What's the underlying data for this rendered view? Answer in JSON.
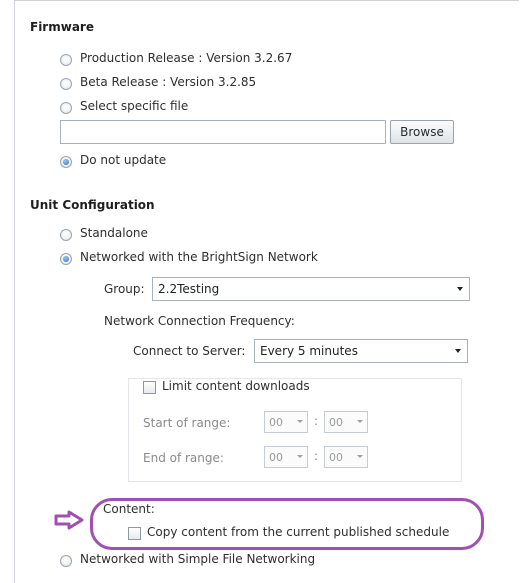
{
  "firmware": {
    "heading": "Firmware",
    "options": [
      {
        "label": "Production Release : Version 3.2.67",
        "selected": false
      },
      {
        "label": "Beta Release : Version 3.2.85",
        "selected": false
      },
      {
        "label": "Select specific file",
        "selected": false
      }
    ],
    "file_path": "",
    "browse_label": "Browse",
    "do_not_update": {
      "label": "Do not update",
      "selected": true
    }
  },
  "unit_config": {
    "heading": "Unit Configuration",
    "standalone": {
      "label": "Standalone",
      "selected": false
    },
    "networked": {
      "label": "Networked with the BrightSign Network",
      "selected": true
    },
    "group_label": "Group:",
    "group_value": "2.2Testing",
    "frequency_label": "Network Connection Frequency:",
    "connect_label": "Connect to Server:",
    "connect_value": "Every 5 minutes",
    "limit": {
      "label": "Limit content downloads",
      "checked": false
    },
    "start_label": "Start of range:",
    "end_label": "End of range:",
    "start_hour": "00",
    "start_minute": "00",
    "end_hour": "00",
    "end_minute": "00",
    "time_separator": ":",
    "content_label": "Content:",
    "copy_content": {
      "label": "Copy content from the current published schedule",
      "checked": false
    },
    "sfn": {
      "label": "Networked with Simple File Networking",
      "selected": false
    }
  },
  "annotation": {
    "highlight_color": "#a24fb3",
    "arrow_icon": "right-arrow-icon"
  }
}
